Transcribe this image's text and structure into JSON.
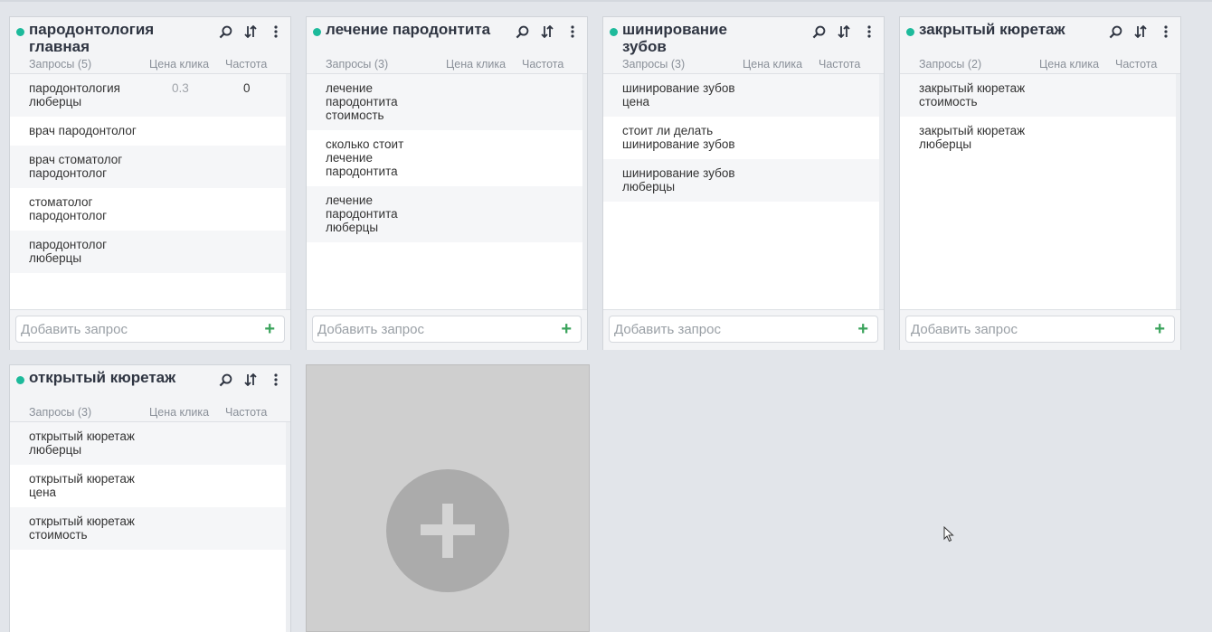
{
  "columns": {
    "queries_prefix": "Запросы",
    "price": "Цена клика",
    "freq": "Частота"
  },
  "add_placeholder": "Добавить запрос",
  "groups": [
    {
      "title": "пародонтология главная",
      "count_label": "Запросы (5)",
      "rows": [
        {
          "q": "пародонтология люберцы",
          "price": "0.3",
          "freq": "0"
        },
        {
          "q": "врач пародонтолог",
          "price": "",
          "freq": ""
        },
        {
          "q": "врач стоматолог пародонтолог",
          "price": "",
          "freq": ""
        },
        {
          "q": "стоматолог пародонтолог",
          "price": "",
          "freq": ""
        },
        {
          "q": "пародонтолог люберцы",
          "price": "",
          "freq": ""
        }
      ]
    },
    {
      "title": "лечение пародонтита",
      "count_label": "Запросы (3)",
      "rows": [
        {
          "q": "лечение пародонтита стоимость",
          "price": "",
          "freq": ""
        },
        {
          "q": "сколько стоит лечение пародонтита",
          "price": "",
          "freq": ""
        },
        {
          "q": "лечение пародонтита люберцы",
          "price": "",
          "freq": ""
        }
      ]
    },
    {
      "title": "шинирование зубов",
      "count_label": "Запросы (3)",
      "rows": [
        {
          "q": "шинирование зубов цена",
          "price": "",
          "freq": ""
        },
        {
          "q": "стоит ли делать шинирование зубов",
          "price": "",
          "freq": ""
        },
        {
          "q": "шинирование зубов люберцы",
          "price": "",
          "freq": ""
        }
      ]
    },
    {
      "title": "закрытый кюретаж",
      "count_label": "Запросы (2)",
      "rows": [
        {
          "q": "закрытый кюретаж стоимость",
          "price": "",
          "freq": ""
        },
        {
          "q": "закрытый кюретаж люберцы",
          "price": "",
          "freq": ""
        }
      ]
    },
    {
      "title": "открытый кюретаж",
      "count_label": "Запросы (3)",
      "rows": [
        {
          "q": "открытый кюретаж люберцы",
          "price": "",
          "freq": ""
        },
        {
          "q": "открытый кюретаж цена",
          "price": "",
          "freq": ""
        },
        {
          "q": "открытый кюретаж стоимость",
          "price": "",
          "freq": ""
        }
      ]
    }
  ],
  "colors": {
    "status_dot": "#1dba9b",
    "add_plus": "#3aa35b",
    "background": "#e2e5ea"
  },
  "icons": [
    "search-icon",
    "sort-icon",
    "more-vertical-icon",
    "plus-icon"
  ]
}
